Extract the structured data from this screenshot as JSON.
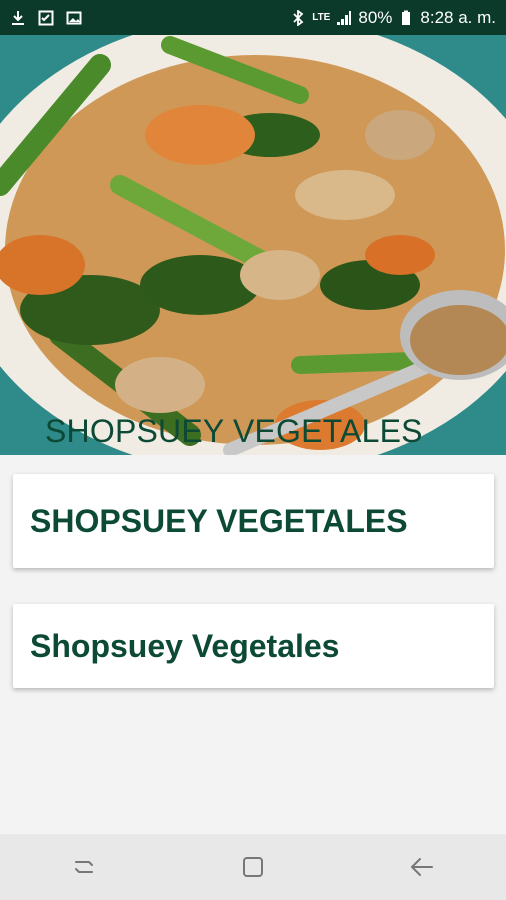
{
  "status_bar": {
    "battery": "80%",
    "time": "8:28 a. m.",
    "network": "LTE",
    "icons": [
      "download-icon",
      "checklist-icon",
      "image-icon",
      "bluetooth-icon",
      "signal-icon",
      "battery-icon"
    ]
  },
  "hero": {
    "title": "SHOPSUEY VEGETALES",
    "image": "dish-photo"
  },
  "cards": [
    {
      "label": "SHOPSUEY VEGETALES"
    },
    {
      "label": "Shopsuey Vegetales"
    }
  ],
  "nav": {
    "icons": [
      "recent-apps-icon",
      "home-icon",
      "back-icon"
    ]
  },
  "colors": {
    "status_bar": "#0b3a2a",
    "accent_text": "#0d4a36"
  }
}
